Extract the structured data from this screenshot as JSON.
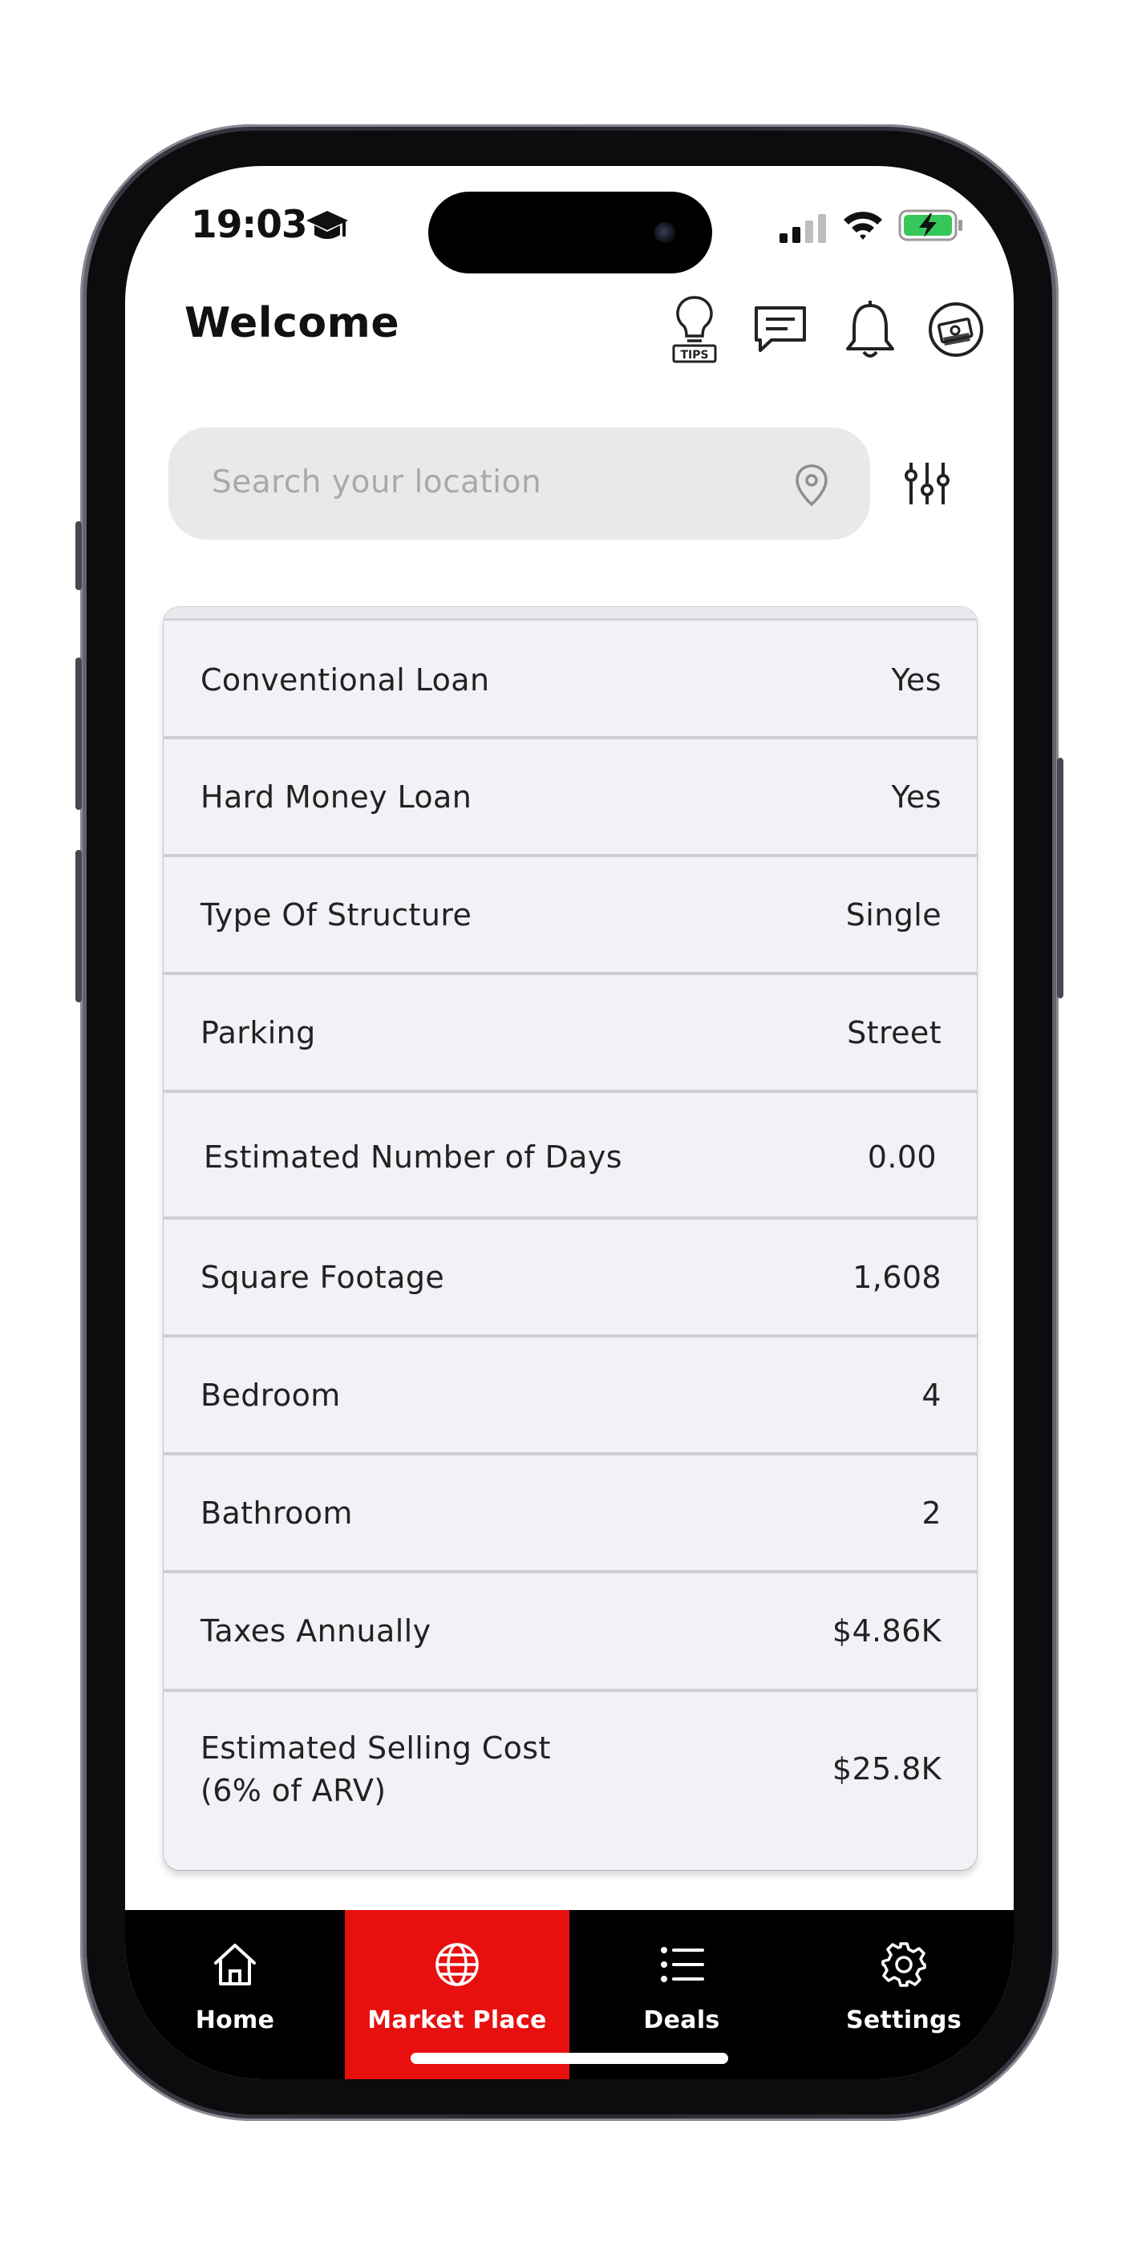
{
  "status_bar": {
    "time": "19:03",
    "time_icon": "graduation-cap-icon",
    "battery_color": "#35c759"
  },
  "header": {
    "title": "Welcome",
    "tips_label": "TIPS",
    "icons": [
      "tips-lightbulb-icon",
      "chat-icon",
      "bell-icon",
      "money-icon"
    ]
  },
  "search": {
    "placeholder": "Search your location",
    "icon": "location-pin-icon",
    "filter_icon": "sliders-icon"
  },
  "details": [
    {
      "label": "Conventional Loan",
      "value": "Yes"
    },
    {
      "label": "Hard Money Loan",
      "value": "Yes"
    },
    {
      "label": "Type Of Structure",
      "value": "Single"
    },
    {
      "label": "Parking",
      "value": "Street"
    },
    {
      "label": "Estimated Number of Days",
      "value": "0.00"
    },
    {
      "label": "Square Footage",
      "value": "1,608"
    },
    {
      "label": "Bedroom",
      "value": "4"
    },
    {
      "label": "Bathroom",
      "value": "2"
    },
    {
      "label": "Taxes Annually",
      "value": "$4.86K"
    },
    {
      "label": "Estimated Selling Cost",
      "label_line2": "(6% of ARV)",
      "value": "$25.8K"
    }
  ],
  "nav": {
    "items": [
      {
        "label": "Home",
        "icon": "home-icon"
      },
      {
        "label": "Market Place",
        "icon": "globe-icon"
      },
      {
        "label": "Deals",
        "icon": "list-icon"
      },
      {
        "label": "Settings",
        "icon": "gear-icon"
      }
    ],
    "active": "Market Place",
    "active_color": "#e8100f"
  }
}
